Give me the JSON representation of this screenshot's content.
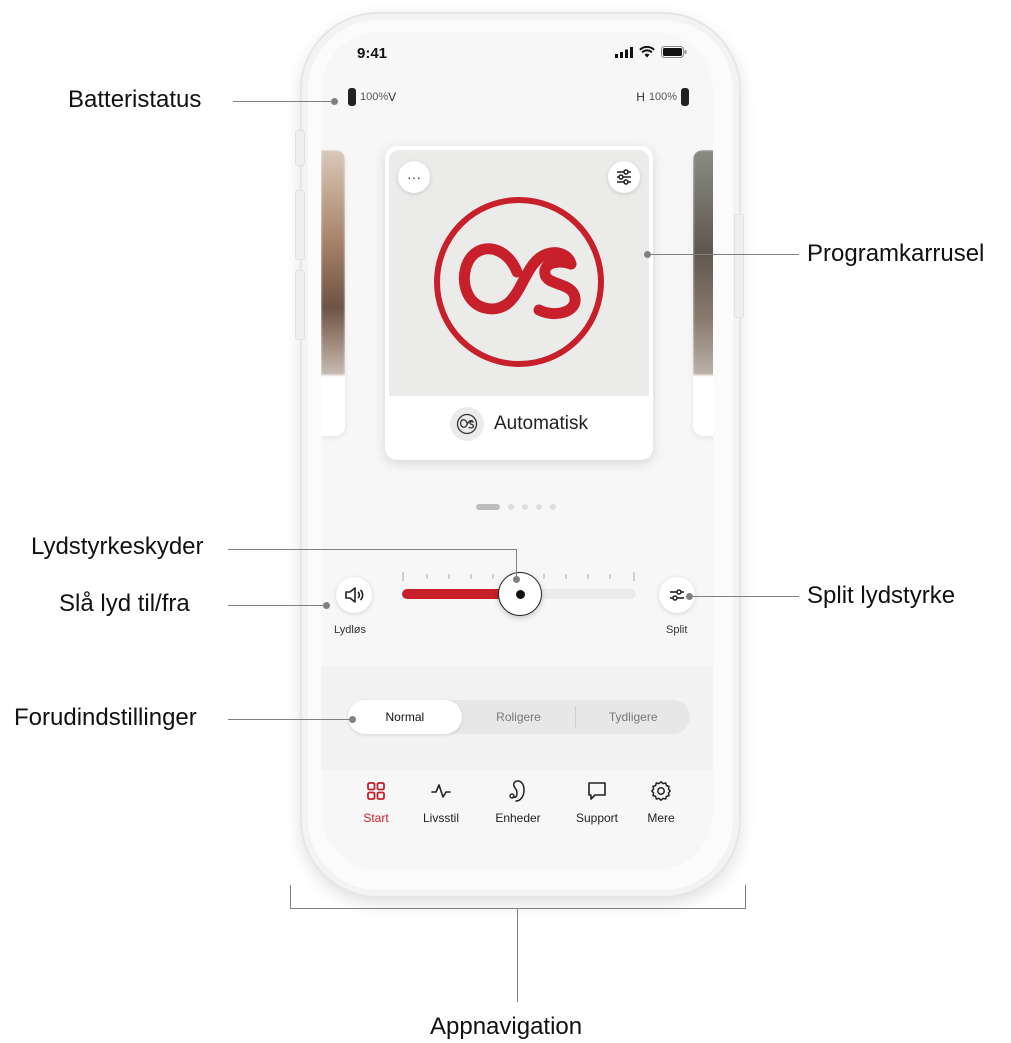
{
  "status_bar": {
    "time": "9:41"
  },
  "battery": {
    "left": {
      "level": "100%",
      "side": "V"
    },
    "right": {
      "level": "100%",
      "side": "H"
    }
  },
  "carousel": {
    "program_name": "Automatisk",
    "page_count": 5,
    "active_page": 1,
    "accent_color": "#c8202a"
  },
  "volume": {
    "mute_label": "Lydløs",
    "split_label": "Split",
    "level_fraction": 0.5
  },
  "presets": {
    "options": [
      "Normal",
      "Roligere",
      "Tydligere"
    ],
    "selected": "Normal"
  },
  "tabs": [
    {
      "label": "Start",
      "icon": "grid-icon",
      "active": true
    },
    {
      "label": "Livsstil",
      "icon": "activity-icon",
      "active": false
    },
    {
      "label": "Enheder",
      "icon": "hearing-aid-icon",
      "active": false
    },
    {
      "label": "Support",
      "icon": "chat-icon",
      "active": false
    },
    {
      "label": "Mere",
      "icon": "gear-icon",
      "active": false
    }
  ],
  "annotations": {
    "battery_status": "Batteristatus",
    "program_carousel": "Programkarrusel",
    "volume_slider": "Lydstyrkeskyder",
    "mute_toggle": "Slå lyd til/fra",
    "split_volume": "Split lydstyrke",
    "presets": "Forudindstillinger",
    "app_navigation": "Appnavigation"
  }
}
